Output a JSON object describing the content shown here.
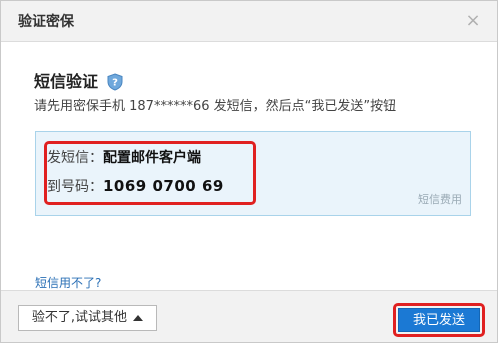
{
  "dialog": {
    "title": "验证密保",
    "close_glyph": "×"
  },
  "verify": {
    "heading": "短信验证",
    "instruction": "请先用密保手机 187******66 发短信，然后点“我已发送”按钮",
    "sms_label": "发短信：",
    "sms_content": "配置邮件客户端",
    "number_label": "到号码：",
    "number_value": "1069 0700 69",
    "fee_link": "短信费用"
  },
  "help_link": "短信用不了?",
  "footer": {
    "other_button": "验不了,试试其他",
    "send_button": "我已发送"
  },
  "icons": {
    "close": "close-icon",
    "shield": "shield-question-icon",
    "caret": "caret-up-icon"
  },
  "colors": {
    "primary_button": "#1b79d4",
    "highlight_border": "#e02020",
    "infobox_bg": "#eaf4fb",
    "link": "#2a6fb5"
  }
}
